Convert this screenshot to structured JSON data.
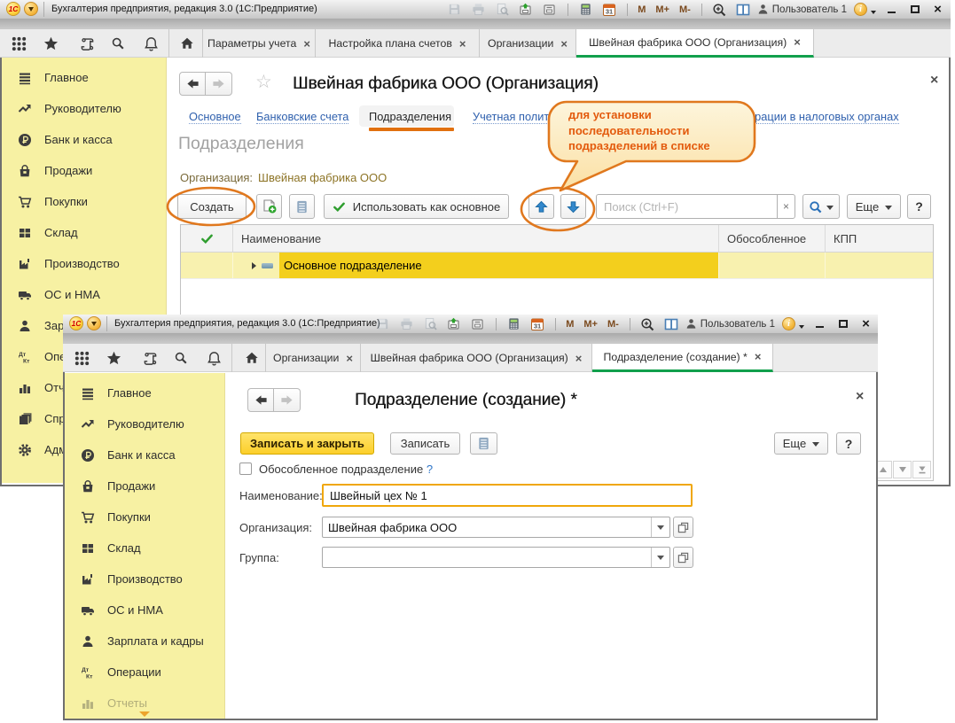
{
  "app": {
    "window_title": "Бухгалтерия предприятия, редакция 3.0  (1С:Предприятие)",
    "logo_text": "1С",
    "user_label": "Пользователь 1",
    "memory": {
      "m": "M",
      "m_plus": "M+",
      "m_minus": "M-"
    },
    "calendar_day": "31"
  },
  "glyphs": {
    "close": "×",
    "star_outline": "☆",
    "question": "?",
    "info_i": "i"
  },
  "colors": {
    "sidebar_yellow": "#f7f1a3",
    "selection_yellow": "#f3cf1d",
    "row_pale_yellow": "#f8f1af",
    "tab_active_underline": "#11a04c",
    "annotation_orange": "#e0781e",
    "link_blue": "#3061ae",
    "org_link_brown": "#8d7426",
    "primary_button_yellow": "#fccf2a",
    "focused_field_border": "#f0a70b",
    "nav_active_underline": "#e1700f"
  },
  "sidebar": {
    "items": [
      "Главное",
      "Руководителю",
      "Банк и касса",
      "Продажи",
      "Покупки",
      "Склад",
      "Производство",
      "ОС и НМА",
      "Зарплата и кадры",
      "Операции",
      "Отчеты",
      "Справочники",
      "Администрирование"
    ]
  },
  "back_window": {
    "tabs": [
      {
        "label": "Параметры учета"
      },
      {
        "label": "Настройка плана счетов"
      },
      {
        "label": "Организации"
      },
      {
        "label": "Швейная фабрика ООО (Организация)"
      }
    ],
    "form": {
      "title": "Швейная фабрика ООО (Организация)",
      "nav_links": {
        "main": "Основное",
        "bank": "Банковские счета",
        "departments": "Подразделения",
        "policy": "Учетная политика",
        "tax": "Регистрации в налоговых органах"
      },
      "heading": "Подразделения",
      "org_label": "Организация:",
      "org_value": "Швейная фабрика ООО",
      "toolbar": {
        "create": "Создать",
        "use_as_main": "Использовать как основное",
        "search_placeholder": "Поиск (Ctrl+F)",
        "more": "Еще",
        "help": "?"
      },
      "table": {
        "col_name": "Наименование",
        "col_detached": "Обособленное",
        "col_kpp": "КПП",
        "row_name": "Основное подразделение"
      }
    }
  },
  "front_window": {
    "tabs": [
      {
        "label": "Организации"
      },
      {
        "label": "Швейная фабрика ООО (Организация)"
      },
      {
        "label": "Подразделение (создание) *"
      }
    ],
    "form": {
      "title": "Подразделение (создание) *",
      "save_and_close": "Записать и закрыть",
      "save": "Записать",
      "more": "Еще",
      "help": "?",
      "checkbox_label": "Обособленное подразделение",
      "checkbox_help": "?",
      "field_name_label": "Наименование:",
      "field_name_value": "Швейный цех № 1",
      "field_org_label": "Организация:",
      "field_org_value": "Швейная фабрика ООО",
      "field_group_label": "Группа:",
      "field_group_value": ""
    }
  },
  "callout": {
    "line1": "для установки",
    "line2": "последовательности",
    "line3": "подразделений в списке"
  }
}
